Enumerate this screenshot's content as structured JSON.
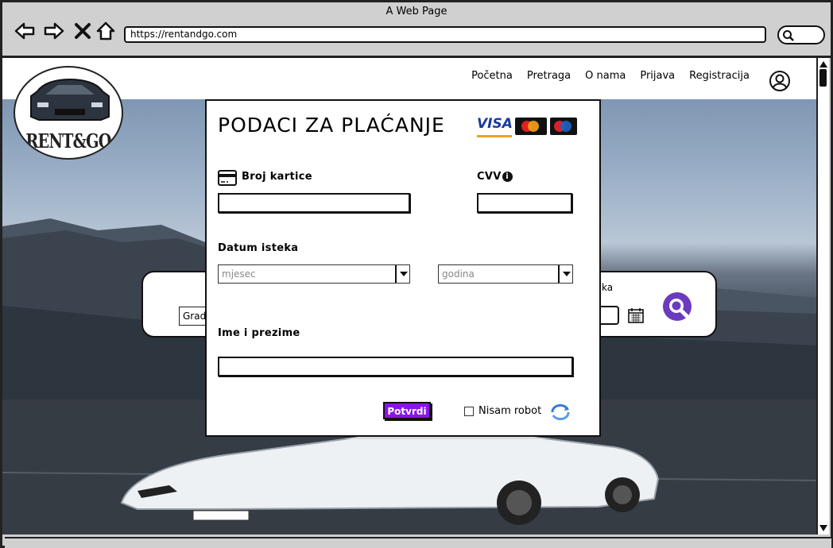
{
  "browser": {
    "window_title": "A Web Page",
    "url": "https://rentandgo.com"
  },
  "nav": {
    "links": [
      "Početna",
      "Pretraga",
      "O nama",
      "Prijava",
      "Registracija"
    ]
  },
  "logo": {
    "text": "RENT&GO"
  },
  "searchbar": {
    "city_field": "Grad",
    "partial_label": "ka"
  },
  "payment_modal": {
    "title": "PODACI ZA PLAĆANJE",
    "card_brands": [
      "VISA",
      "mastercard",
      "maestro"
    ],
    "visa_text": "VISA",
    "card_number_label": "Broj kartice",
    "cvv_label": "CVV",
    "expiry_label": "Datum isteka",
    "month_placeholder": "mjesec",
    "year_placeholder": "godina",
    "name_label": "Ime i prezime",
    "confirm_button": "Potvrdi",
    "robot_label": "Nisam robot"
  },
  "colors": {
    "accent_purple": "#8a16e6",
    "search_icon_purple": "#6b3bbf"
  },
  "icons": [
    "back-arrow-icon",
    "forward-arrow-icon",
    "close-icon",
    "home-icon",
    "search-icon",
    "user-icon",
    "credit-card-icon",
    "info-icon",
    "calendar-icon",
    "recaptcha-icon"
  ]
}
